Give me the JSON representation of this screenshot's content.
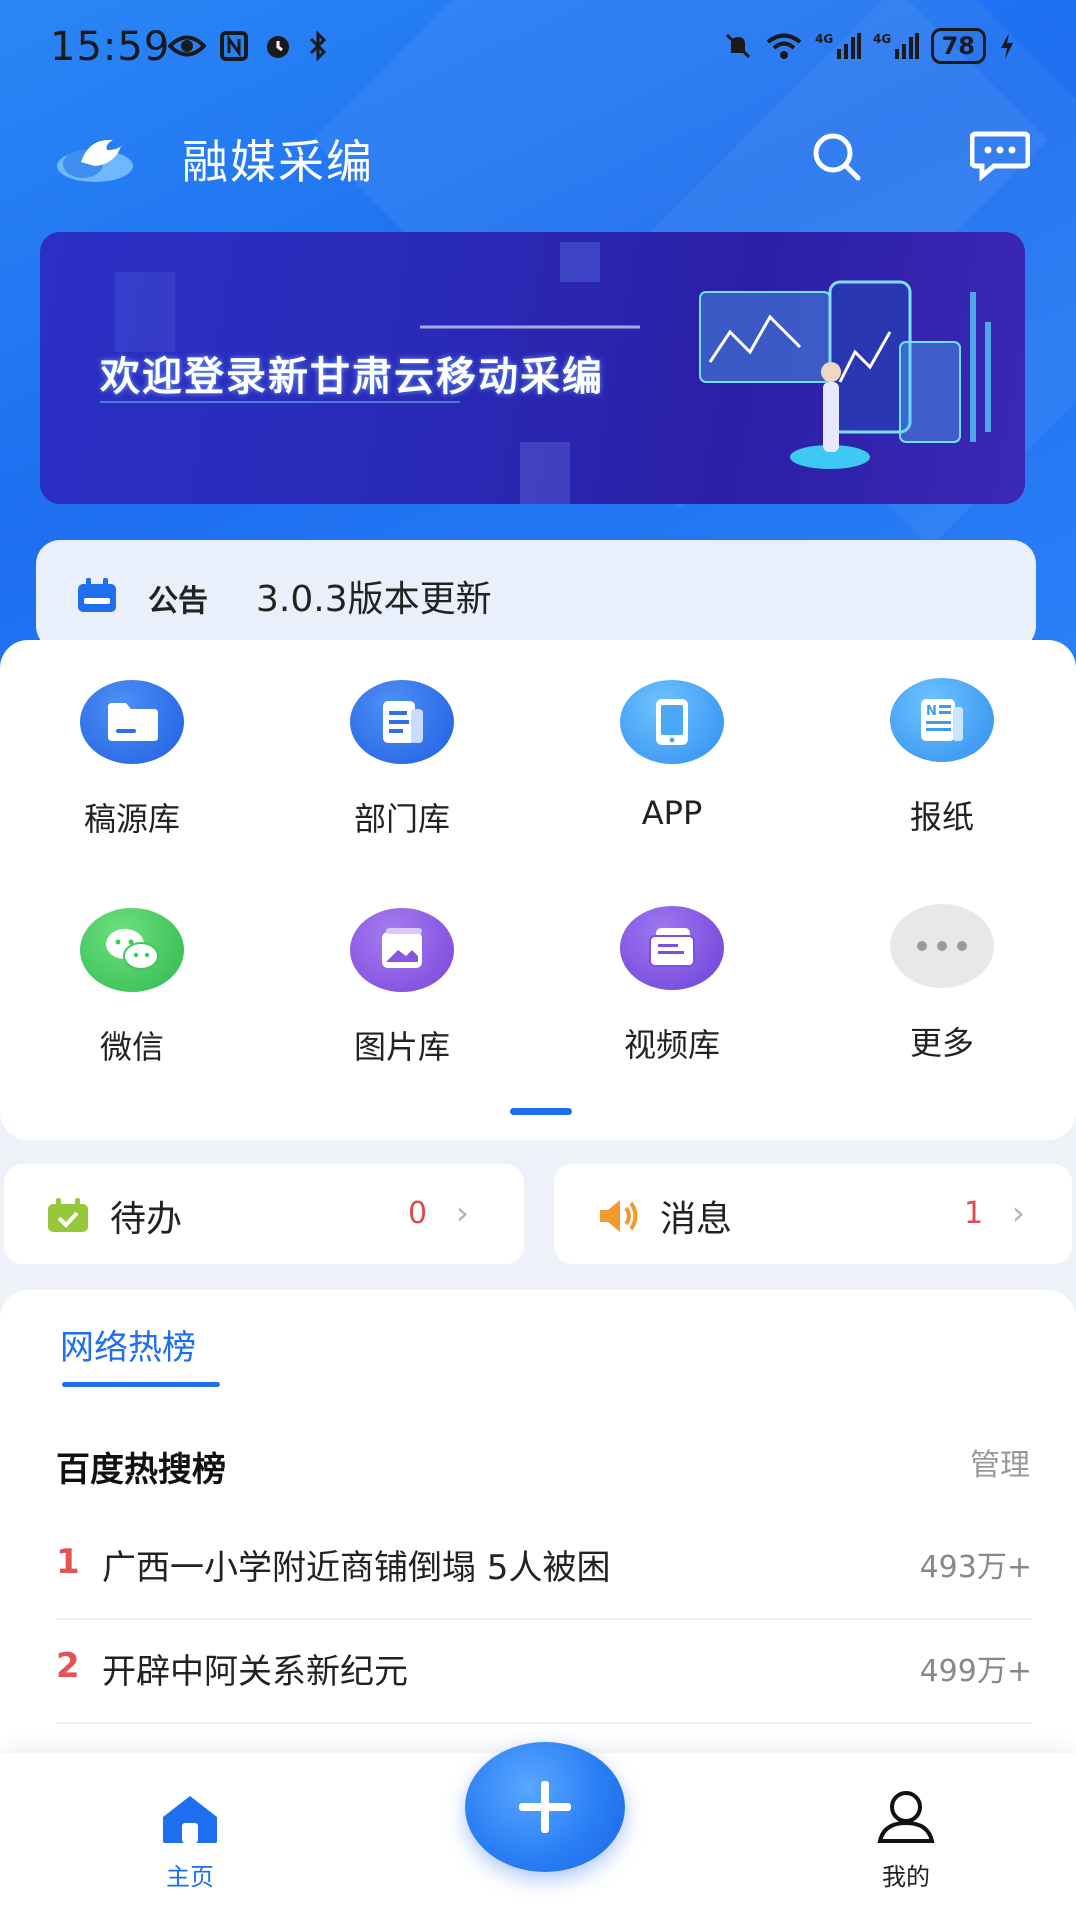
{
  "status_bar": {
    "time": "15:59",
    "battery": "78",
    "icons_left": [
      "eye-icon",
      "nfc-icon",
      "alarm-icon",
      "bluetooth-icon"
    ],
    "icons_right": [
      "mute-icon",
      "wifi-icon",
      "signal-4g-icon",
      "signal-4g-icon",
      "battery-icon",
      "charging-icon"
    ]
  },
  "header": {
    "title": "融媒采编",
    "actions": [
      "search-icon",
      "message-icon"
    ]
  },
  "banner": {
    "text": "欢迎登录新甘肃云移动采编"
  },
  "notice": {
    "label": "公告",
    "text": "3.0.3版本更新"
  },
  "grid": {
    "items": [
      {
        "label": "稿源库",
        "icon": "folder-icon",
        "color": "#2f6fe8"
      },
      {
        "label": "部门库",
        "icon": "document-icon",
        "color": "#2f6fe8"
      },
      {
        "label": "APP",
        "icon": "tablet-icon",
        "color": "#3b9cf2"
      },
      {
        "label": "报纸",
        "icon": "newspaper-icon",
        "color": "#3b9cf2"
      },
      {
        "label": "微信",
        "icon": "wechat-icon",
        "color": "#3cc85a"
      },
      {
        "label": "图片库",
        "icon": "image-icon",
        "color": "#8a55e0"
      },
      {
        "label": "视频库",
        "icon": "video-library-icon",
        "color": "#7d4fe0"
      },
      {
        "label": "更多",
        "icon": "more-icon",
        "color": "#e8e8e8"
      }
    ]
  },
  "todo": {
    "label": "待办",
    "count": "0"
  },
  "messages": {
    "label": "消息",
    "count": "1"
  },
  "hot": {
    "tab": "网络热榜",
    "title": "百度热搜榜",
    "manage": "管理",
    "items": [
      {
        "rank": "1",
        "text": "广西一小学附近商铺倒塌 5人被困",
        "heat": "493万+"
      },
      {
        "rank": "2",
        "text": "开辟中阿关系新纪元",
        "heat": "499万+"
      }
    ]
  },
  "tabbar": {
    "home": "主页",
    "me": "我的"
  },
  "colors": {
    "primary": "#1d6ff0",
    "rank": "#e25555",
    "count": "#e04b4b"
  }
}
